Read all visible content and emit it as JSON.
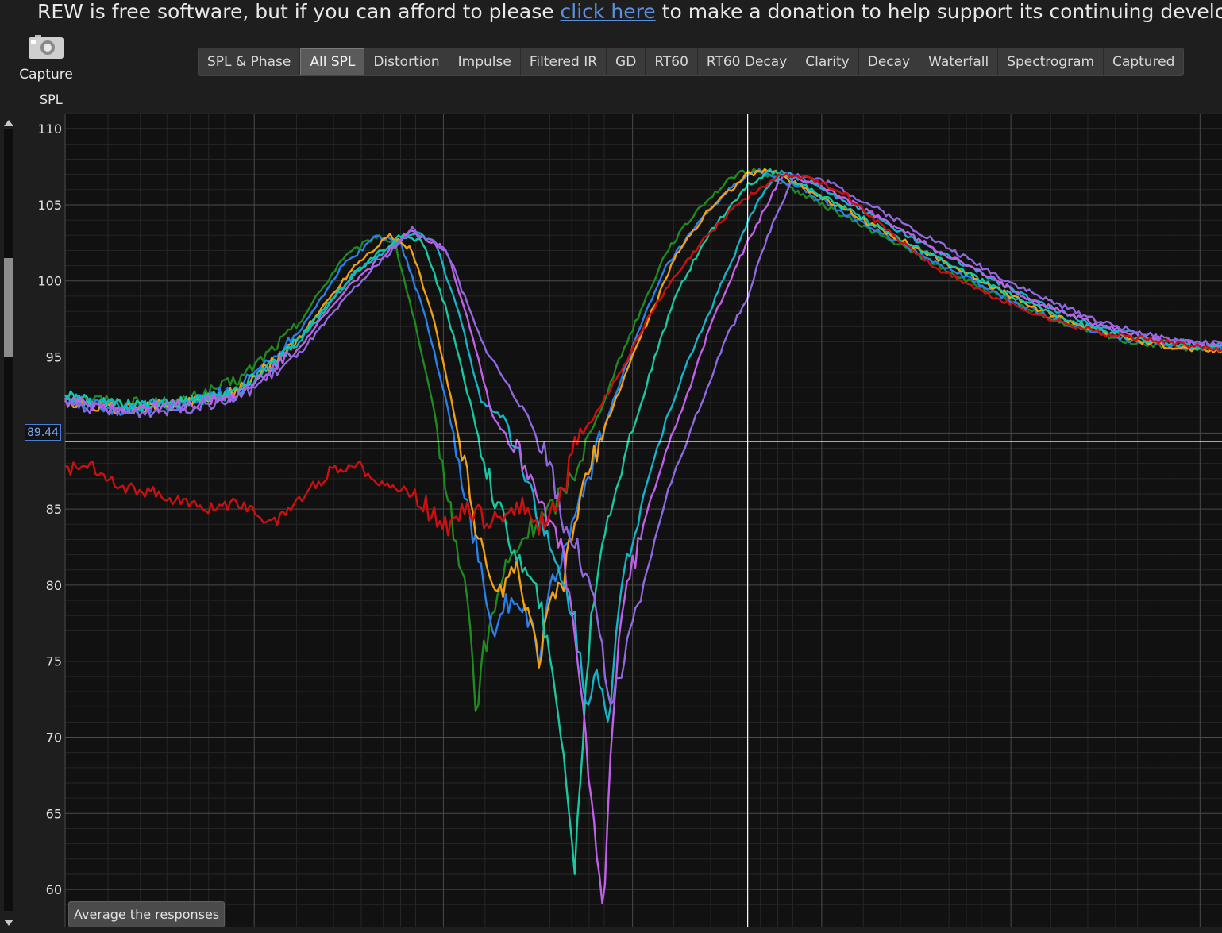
{
  "banner": {
    "text_before": "REW is free software, but if you can afford to please ",
    "link_text": "click here",
    "text_after": " to make a donation to help support its continuing developmen"
  },
  "capture": {
    "label": "Capture",
    "icon": "camera-icon"
  },
  "tabs": [
    {
      "label": "SPL & Phase",
      "active": false
    },
    {
      "label": "All SPL",
      "active": true
    },
    {
      "label": "Distortion",
      "active": false
    },
    {
      "label": "Impulse",
      "active": false
    },
    {
      "label": "Filtered IR",
      "active": false
    },
    {
      "label": "GD",
      "active": false
    },
    {
      "label": "RT60",
      "active": false
    },
    {
      "label": "RT60 Decay",
      "active": false
    },
    {
      "label": "Clarity",
      "active": false
    },
    {
      "label": "Decay",
      "active": false
    },
    {
      "label": "Waterfall",
      "active": false
    },
    {
      "label": "Spectrogram",
      "active": false
    },
    {
      "label": "Captured",
      "active": false
    }
  ],
  "y_axis_title": "SPL",
  "cursor_value": "89.44",
  "average_button": "Average the responses",
  "colors": {
    "background": "#111111",
    "grid_major": "#4a4a4a",
    "grid_minor": "#262626",
    "cursor": "#ffffff",
    "accent": "#4a7fd6"
  },
  "chart_data": {
    "type": "line",
    "ylabel": "SPL",
    "ylim": [
      57.5,
      111
    ],
    "y_ticks": [
      110,
      105,
      100,
      95,
      90,
      85,
      80,
      75,
      70,
      65,
      60
    ],
    "x_range": [
      0,
      1
    ],
    "grid": true,
    "cursor": {
      "y": 89.44,
      "x": 0.59
    },
    "series": [
      {
        "color": "#1f8a1f",
        "x": [
          0,
          0.05,
          0.1,
          0.15,
          0.2,
          0.24,
          0.27,
          0.285,
          0.3,
          0.32,
          0.33,
          0.35,
          0.355,
          0.36,
          0.38,
          0.4,
          0.42,
          0.44,
          0.46,
          0.48,
          0.5,
          0.52,
          0.55,
          0.58,
          0.6,
          0.63,
          0.68,
          0.73,
          0.78,
          0.82,
          0.87,
          0.92,
          0.97,
          1.0
        ],
        "y": [
          92.5,
          92,
          92,
          93.5,
          97,
          101.5,
          103,
          102.5,
          98,
          91,
          86,
          78,
          71,
          75,
          81,
          83.5,
          85,
          87.5,
          91,
          95,
          98.5,
          102,
          105,
          107,
          107.3,
          106,
          104,
          102,
          100,
          98.5,
          97,
          96,
          95.5,
          95.5
        ]
      },
      {
        "color": "#2a7fe8",
        "x": [
          0,
          0.05,
          0.1,
          0.15,
          0.2,
          0.24,
          0.27,
          0.29,
          0.31,
          0.33,
          0.345,
          0.36,
          0.37,
          0.38,
          0.4,
          0.41,
          0.42,
          0.44,
          0.46,
          0.48,
          0.5,
          0.52,
          0.55,
          0.58,
          0.6,
          0.63,
          0.68,
          0.73,
          0.78,
          0.82,
          0.87,
          0.92,
          0.97,
          1.0
        ],
        "y": [
          92.2,
          91.5,
          91.8,
          93,
          96.5,
          101,
          103,
          102.5,
          98,
          92,
          86,
          81,
          76,
          79,
          78,
          75,
          80,
          84,
          89,
          93.5,
          97.5,
          101,
          104,
          106.5,
          107.2,
          106.3,
          104.2,
          102.1,
          100.2,
          98.6,
          97.1,
          96.1,
          95.6,
          95.6
        ]
      },
      {
        "color": "#f0a010",
        "x": [
          0,
          0.05,
          0.1,
          0.15,
          0.2,
          0.25,
          0.28,
          0.3,
          0.32,
          0.34,
          0.355,
          0.37,
          0.39,
          0.41,
          0.42,
          0.43,
          0.44,
          0.45,
          0.47,
          0.49,
          0.51,
          0.53,
          0.56,
          0.59,
          0.61,
          0.64,
          0.69,
          0.74,
          0.79,
          0.83,
          0.88,
          0.93,
          0.98,
          1.0
        ],
        "y": [
          92,
          91.6,
          91.9,
          92.8,
          96,
          101,
          103,
          102,
          97,
          90,
          84,
          79,
          81,
          75,
          79,
          80,
          84,
          87,
          91,
          95,
          98.5,
          102,
          105,
          107,
          107.3,
          106.1,
          104,
          102,
          100.1,
          98.5,
          97,
          96,
          95.4,
          95.4
        ]
      },
      {
        "color": "#18c8a0",
        "x": [
          0,
          0.05,
          0.1,
          0.15,
          0.2,
          0.25,
          0.29,
          0.31,
          0.33,
          0.35,
          0.37,
          0.39,
          0.41,
          0.43,
          0.44,
          0.45,
          0.455,
          0.46,
          0.47,
          0.49,
          0.51,
          0.53,
          0.56,
          0.59,
          0.61,
          0.64,
          0.69,
          0.74,
          0.79,
          0.83,
          0.88,
          0.93,
          0.98,
          1.0
        ],
        "y": [
          92.4,
          91.8,
          92,
          92.8,
          96,
          100.5,
          103,
          102.5,
          98,
          92,
          86,
          82,
          79,
          70,
          61,
          73,
          78,
          81,
          85,
          90,
          95,
          99.5,
          103.5,
          106.3,
          107.2,
          106.2,
          104.1,
          102,
          100.1,
          98.6,
          97.1,
          96.1,
          95.7,
          95.7
        ]
      },
      {
        "color": "#14b4c8",
        "x": [
          0,
          0.05,
          0.1,
          0.15,
          0.2,
          0.25,
          0.3,
          0.32,
          0.34,
          0.36,
          0.38,
          0.4,
          0.42,
          0.44,
          0.45,
          0.46,
          0.47,
          0.48,
          0.5,
          0.52,
          0.54,
          0.56,
          0.58,
          0.6,
          0.62,
          0.65,
          0.7,
          0.75,
          0.8,
          0.84,
          0.89,
          0.94,
          0.99,
          1.0
        ],
        "y": [
          92.3,
          91.7,
          92,
          92.6,
          95.8,
          100.5,
          103.2,
          102.5,
          98,
          92,
          91,
          87,
          82,
          78,
          72,
          75,
          70,
          80,
          86,
          91,
          95,
          98.5,
          102,
          105.5,
          107.2,
          106.3,
          104.2,
          102.1,
          100.2,
          98.6,
          97.1,
          96.2,
          95.8,
          95.8
        ]
      },
      {
        "color": "#c060e8",
        "x": [
          0,
          0.05,
          0.1,
          0.15,
          0.2,
          0.25,
          0.3,
          0.33,
          0.35,
          0.37,
          0.39,
          0.41,
          0.43,
          0.44,
          0.45,
          0.46,
          0.465,
          0.47,
          0.48,
          0.5,
          0.52,
          0.54,
          0.56,
          0.58,
          0.6,
          0.62,
          0.65,
          0.7,
          0.75,
          0.8,
          0.84,
          0.89,
          0.94,
          0.99,
          1.0
        ],
        "y": [
          92.1,
          91.6,
          91.8,
          92.5,
          95.5,
          100,
          103.3,
          102,
          97,
          91,
          89,
          86,
          82,
          77,
          70,
          62,
          58,
          67,
          78,
          84,
          89,
          93,
          97.5,
          101,
          104,
          107,
          106.4,
          104.3,
          102.2,
          100.2,
          98.6,
          97.2,
          96.2,
          95.8,
          95.8
        ]
      },
      {
        "color": "#9068e0",
        "x": [
          0,
          0.05,
          0.1,
          0.15,
          0.2,
          0.25,
          0.3,
          0.33,
          0.36,
          0.38,
          0.4,
          0.42,
          0.43,
          0.44,
          0.46,
          0.47,
          0.48,
          0.5,
          0.52,
          0.53,
          0.55,
          0.57,
          0.59,
          0.61,
          0.63,
          0.66,
          0.71,
          0.76,
          0.81,
          0.85,
          0.9,
          0.95,
          0.99,
          1.0
        ],
        "y": [
          92,
          91.3,
          91.6,
          92.3,
          95,
          99.5,
          103.4,
          102,
          96,
          93.5,
          91,
          88,
          84,
          83,
          78,
          72,
          74,
          80,
          86,
          88,
          92,
          96,
          99,
          103.5,
          107,
          106.5,
          104.4,
          102.3,
          100.2,
          98.7,
          97.2,
          96.2,
          95.9,
          95.9
        ]
      },
      {
        "color": "#cc1010",
        "x": [
          0,
          0.02,
          0.05,
          0.08,
          0.12,
          0.15,
          0.18,
          0.2,
          0.23,
          0.25,
          0.28,
          0.3,
          0.33,
          0.35,
          0.37,
          0.39,
          0.41,
          0.42,
          0.43,
          0.44,
          0.46,
          0.48,
          0.5,
          0.52,
          0.55,
          0.58,
          0.6,
          0.62,
          0.64,
          0.67,
          0.7,
          0.75,
          0.8,
          0.85,
          0.9,
          0.95,
          1.0
        ],
        "y": [
          87.5,
          88,
          86.5,
          86,
          85,
          85.5,
          84,
          85.5,
          87.5,
          88,
          86.5,
          86,
          84,
          85,
          84,
          85.5,
          84,
          85,
          86,
          89,
          91.5,
          94,
          97,
          99.5,
          102.5,
          105,
          106,
          107,
          106.8,
          106,
          104,
          101,
          99,
          97.5,
          96.5,
          96,
          95.5
        ]
      }
    ]
  }
}
